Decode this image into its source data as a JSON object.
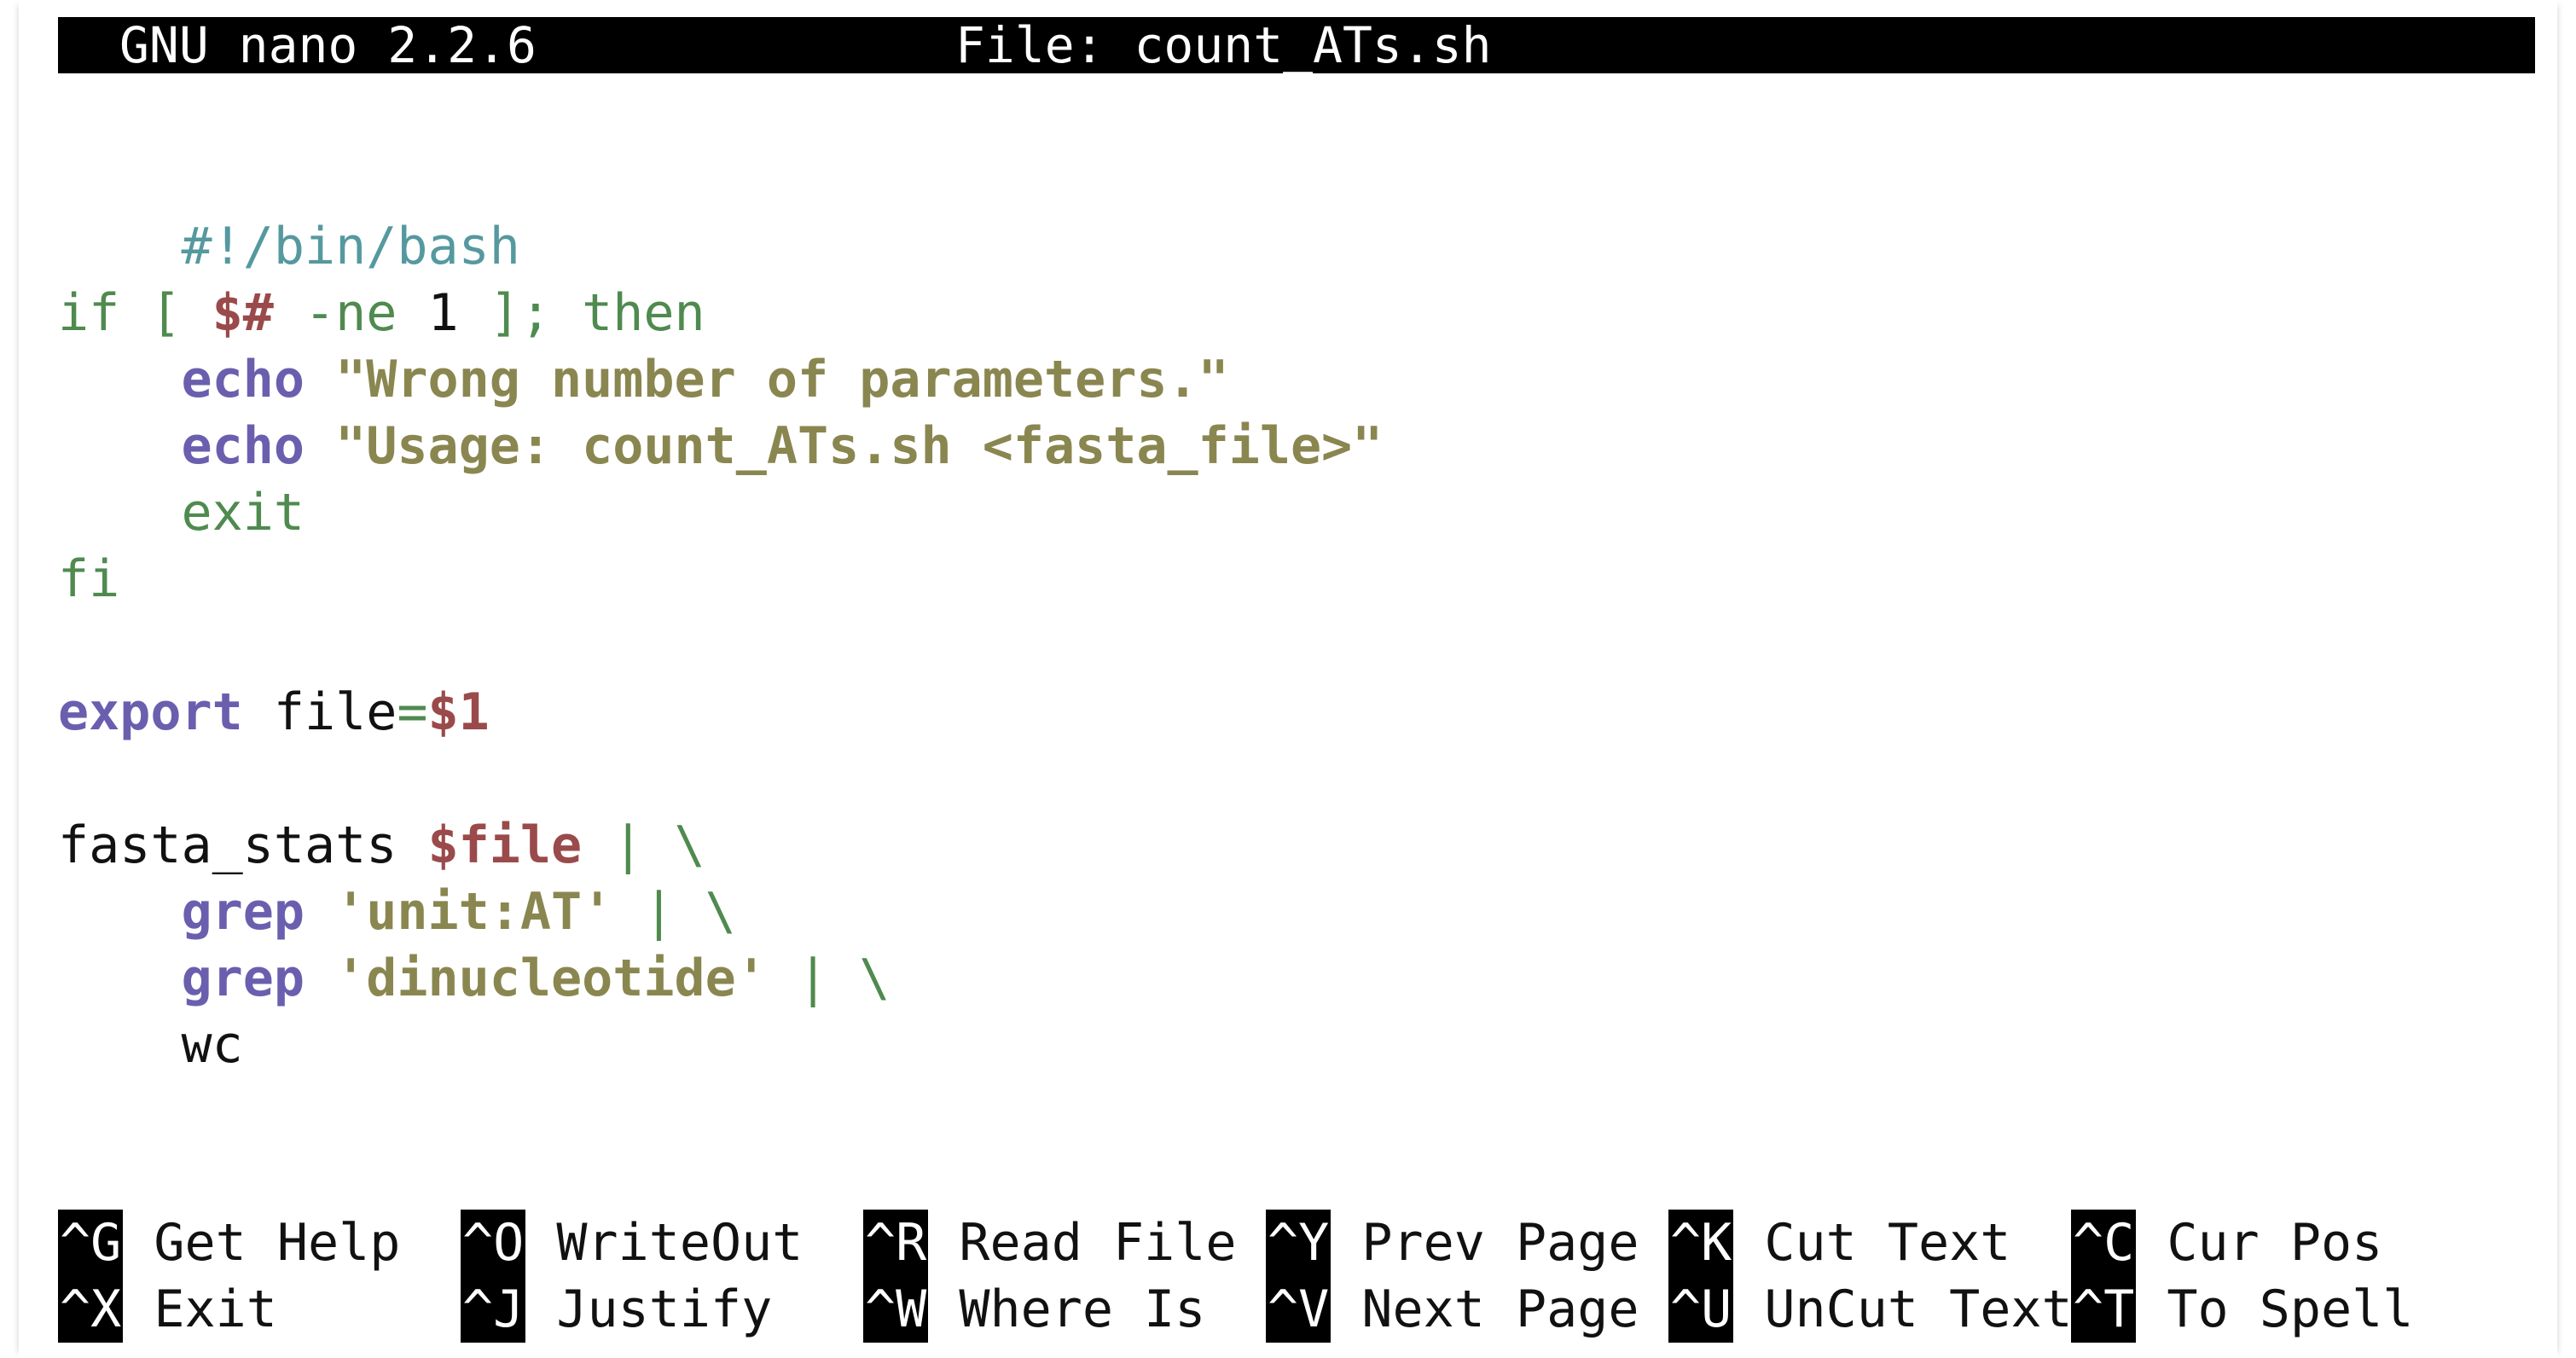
{
  "app": {
    "title": "GNU nano 2.2.6",
    "file_label": "File: count_ATs.sh"
  },
  "code": {
    "shebang": "#!/bin/bash",
    "if_kw": "if",
    "lbr": " [ ",
    "argc": "$#",
    "ne": " -ne ",
    "one": "1",
    "rbr": " ]; ",
    "then_kw": "then",
    "indent": "    ",
    "echo1_cmd": "echo",
    "echo1_str": " \"Wrong number of parameters.\"",
    "echo2_cmd": "echo",
    "echo2_str": " \"Usage: count_ATs.sh <fasta_file>\"",
    "exit_kw": "exit",
    "fi_kw": "fi",
    "export_kw": "export",
    "export_name": " file",
    "export_eq": "=",
    "export_val": "$1",
    "stats_cmd": "fasta_stats ",
    "stats_var": "$file",
    "stats_pipe": " | \\",
    "grep1_cmd": "grep",
    "grep1_str": " 'unit:AT'",
    "grep1_pipe": " | \\",
    "grep2_cmd": "grep",
    "grep2_str": " 'dinucleotide'",
    "grep2_pipe": " | \\",
    "wc_cmd": "wc"
  },
  "shortcuts": [
    {
      "key": "^G",
      "label": " Get Help"
    },
    {
      "key": "^O",
      "label": " WriteOut"
    },
    {
      "key": "^R",
      "label": " Read File"
    },
    {
      "key": "^Y",
      "label": " Prev Page"
    },
    {
      "key": "^K",
      "label": " Cut Text"
    },
    {
      "key": "^C",
      "label": " Cur Pos"
    },
    {
      "key": "^X",
      "label": " Exit"
    },
    {
      "key": "^J",
      "label": " Justify"
    },
    {
      "key": "^W",
      "label": " Where Is"
    },
    {
      "key": "^V",
      "label": " Next Page"
    },
    {
      "key": "^U",
      "label": " UnCut Text"
    },
    {
      "key": "^T",
      "label": " To Spell"
    }
  ]
}
